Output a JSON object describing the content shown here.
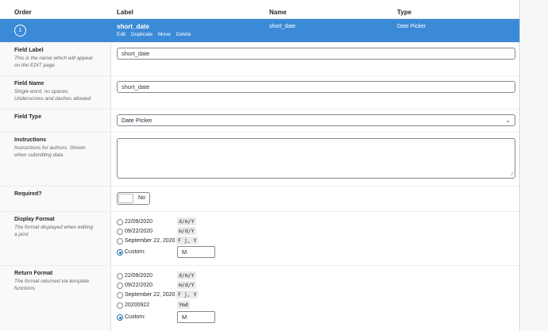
{
  "header": {
    "order": "Order",
    "label": "Label",
    "name": "Name",
    "type": "Type"
  },
  "field": {
    "order": "1",
    "label": "short_date",
    "actions": [
      "Edit",
      "Duplicate",
      "Move",
      "Delete"
    ],
    "name": "short_date",
    "type": "Date Picker",
    "accent": "#3b8ad8"
  },
  "settings": {
    "field_label": {
      "title": "Field Label",
      "desc": "This is the name which will appear on the EDIT page",
      "value": "short_date"
    },
    "field_name": {
      "title": "Field Name",
      "desc": "Single word, no spaces. Underscores and dashes allowed",
      "value": "short_date"
    },
    "field_type": {
      "title": "Field Type",
      "value": "Date Picker"
    },
    "instructions": {
      "title": "Instructions",
      "desc": "Instructions for authors. Shown when submitting data",
      "value": ""
    },
    "required": {
      "title": "Required?",
      "value": "No"
    },
    "display_format": {
      "title": "Display Format",
      "desc": "The format displayed when editing a post",
      "options": [
        {
          "label": "22/09/2020",
          "code": "d/m/Y"
        },
        {
          "label": "09/22/2020",
          "code": "m/d/Y"
        },
        {
          "label": "September 22, 2020",
          "code": "F j, Y"
        }
      ],
      "custom_label": "Custom:",
      "custom_value": "M"
    },
    "return_format": {
      "title": "Return Format",
      "desc": "The format returned via template functions",
      "options": [
        {
          "label": "22/09/2020",
          "code": "d/m/Y"
        },
        {
          "label": "09/22/2020",
          "code": "m/d/Y"
        },
        {
          "label": "September 22, 2020",
          "code": "F j, Y"
        },
        {
          "label": "20200922",
          "code": "Ymd"
        }
      ],
      "custom_label": "Custom:",
      "custom_value": "M"
    }
  }
}
